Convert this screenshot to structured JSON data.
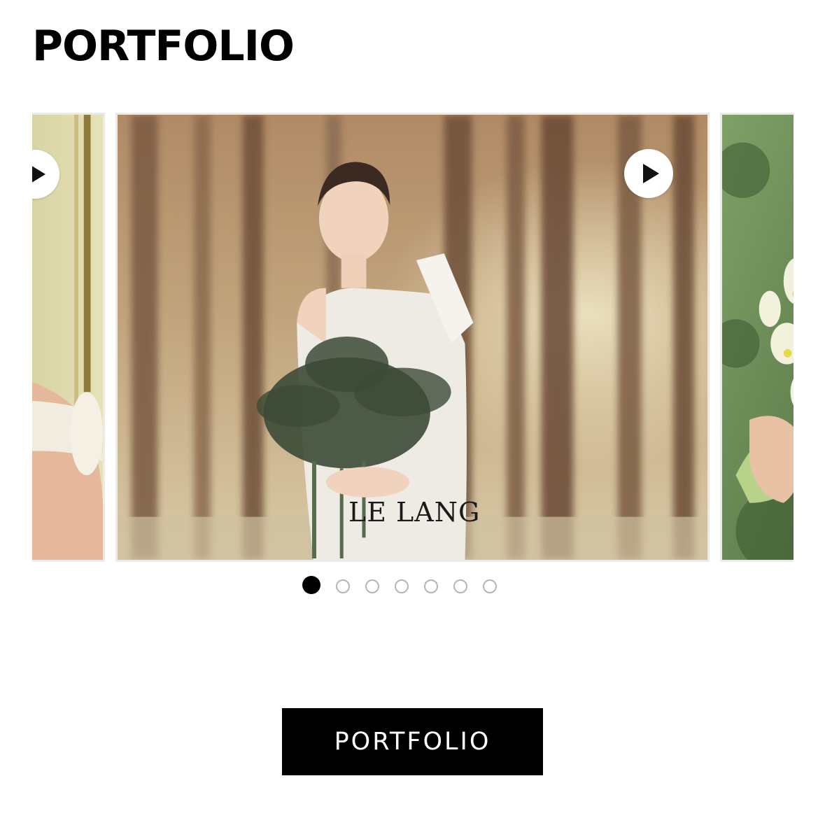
{
  "section": {
    "title": "PORTFOLIO"
  },
  "carousel": {
    "slides": [
      {
        "position": "previous",
        "media": "video",
        "icon": "play-icon"
      },
      {
        "position": "current",
        "media": "video",
        "icon": "play-icon",
        "watermark": "LE LANG"
      },
      {
        "position": "next",
        "media": "image"
      }
    ],
    "page_count": 7,
    "active_page": 1
  },
  "cta": {
    "label": "PORTFOLIO"
  },
  "colors": {
    "text": "#000000",
    "button_bg": "#000000",
    "button_text": "#ffffff",
    "dot_active": "#000000",
    "dot_inactive": "#b5b5b5"
  }
}
